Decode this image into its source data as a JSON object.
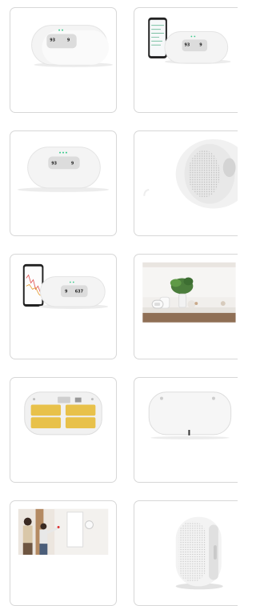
{
  "gallery": {
    "thumbnails": [
      {
        "name": "thumb-1",
        "lcd": [
          "93",
          "9"
        ]
      },
      {
        "name": "thumb-2",
        "lcd": [
          "93",
          "9"
        ]
      },
      {
        "name": "thumb-3",
        "lcd": [
          "93",
          "9"
        ]
      },
      {
        "name": "thumb-4"
      },
      {
        "name": "thumb-5",
        "lcd": [
          "9",
          "637"
        ]
      },
      {
        "name": "thumb-6"
      },
      {
        "name": "thumb-7"
      },
      {
        "name": "thumb-8"
      },
      {
        "name": "thumb-9"
      },
      {
        "name": "thumb-10"
      }
    ]
  }
}
